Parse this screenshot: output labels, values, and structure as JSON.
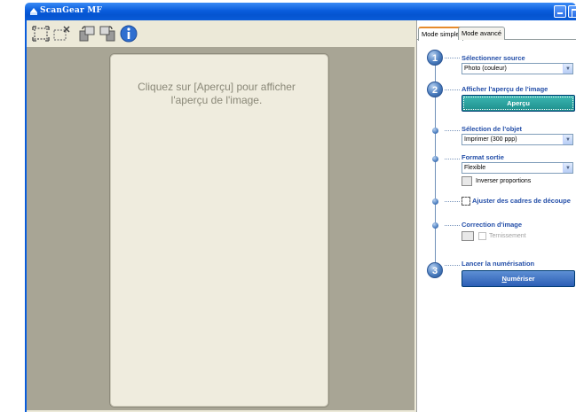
{
  "window": {
    "title": "ScanGear MF"
  },
  "preview": {
    "hint": "Cliquez sur [Aperçu] pour afficher l'aperçu de l'image."
  },
  "toolbar": {
    "tools": [
      "auto-crop-icon",
      "clear-crop-icon",
      "rotate-left-icon",
      "rotate-right-icon",
      "info-icon"
    ]
  },
  "tabs": {
    "simple": "Mode simple",
    "advanced": "Mode avancé"
  },
  "steps": {
    "source": {
      "number": "1",
      "title": "Sélectionner source",
      "value": "Photo (couleur)"
    },
    "preview": {
      "number": "2",
      "title": "Afficher l'aperçu de l'image",
      "button": "Aperçu"
    },
    "object": {
      "title": "Sélection de l'objet",
      "value": "Imprimer (300 ppp)"
    },
    "output": {
      "title": "Format sortie",
      "value": "Flexible",
      "invert_label": "Inverser proportions"
    },
    "crop": {
      "title": "Ajuster des cadres de découpe"
    },
    "correction": {
      "title": "Correction d'image",
      "option_label": "Ternissement"
    },
    "scan": {
      "number": "3",
      "title": "Lancer la numérisation",
      "button_first": "N",
      "button_rest": "umériser"
    }
  }
}
